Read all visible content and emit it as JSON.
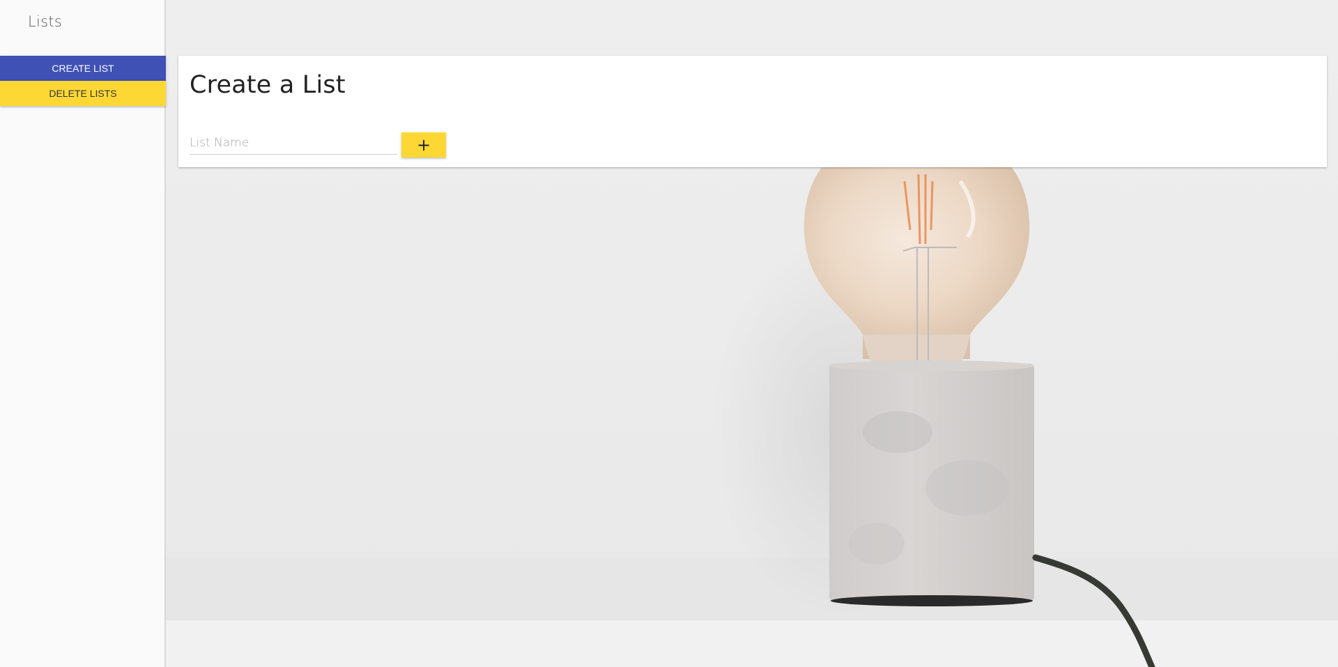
{
  "sidebar": {
    "title": "Lists",
    "create_label": "CREATE LIST",
    "delete_label": "DELETE LISTS"
  },
  "card": {
    "title": "Create a List",
    "input_placeholder": "List Name",
    "input_value": "",
    "add_icon": "plus-icon",
    "add_glyph": "+"
  },
  "background": {
    "image": "lightbulb-lamp-photo"
  },
  "colors": {
    "primary": "#3f51b5",
    "accent": "#fdd835"
  }
}
